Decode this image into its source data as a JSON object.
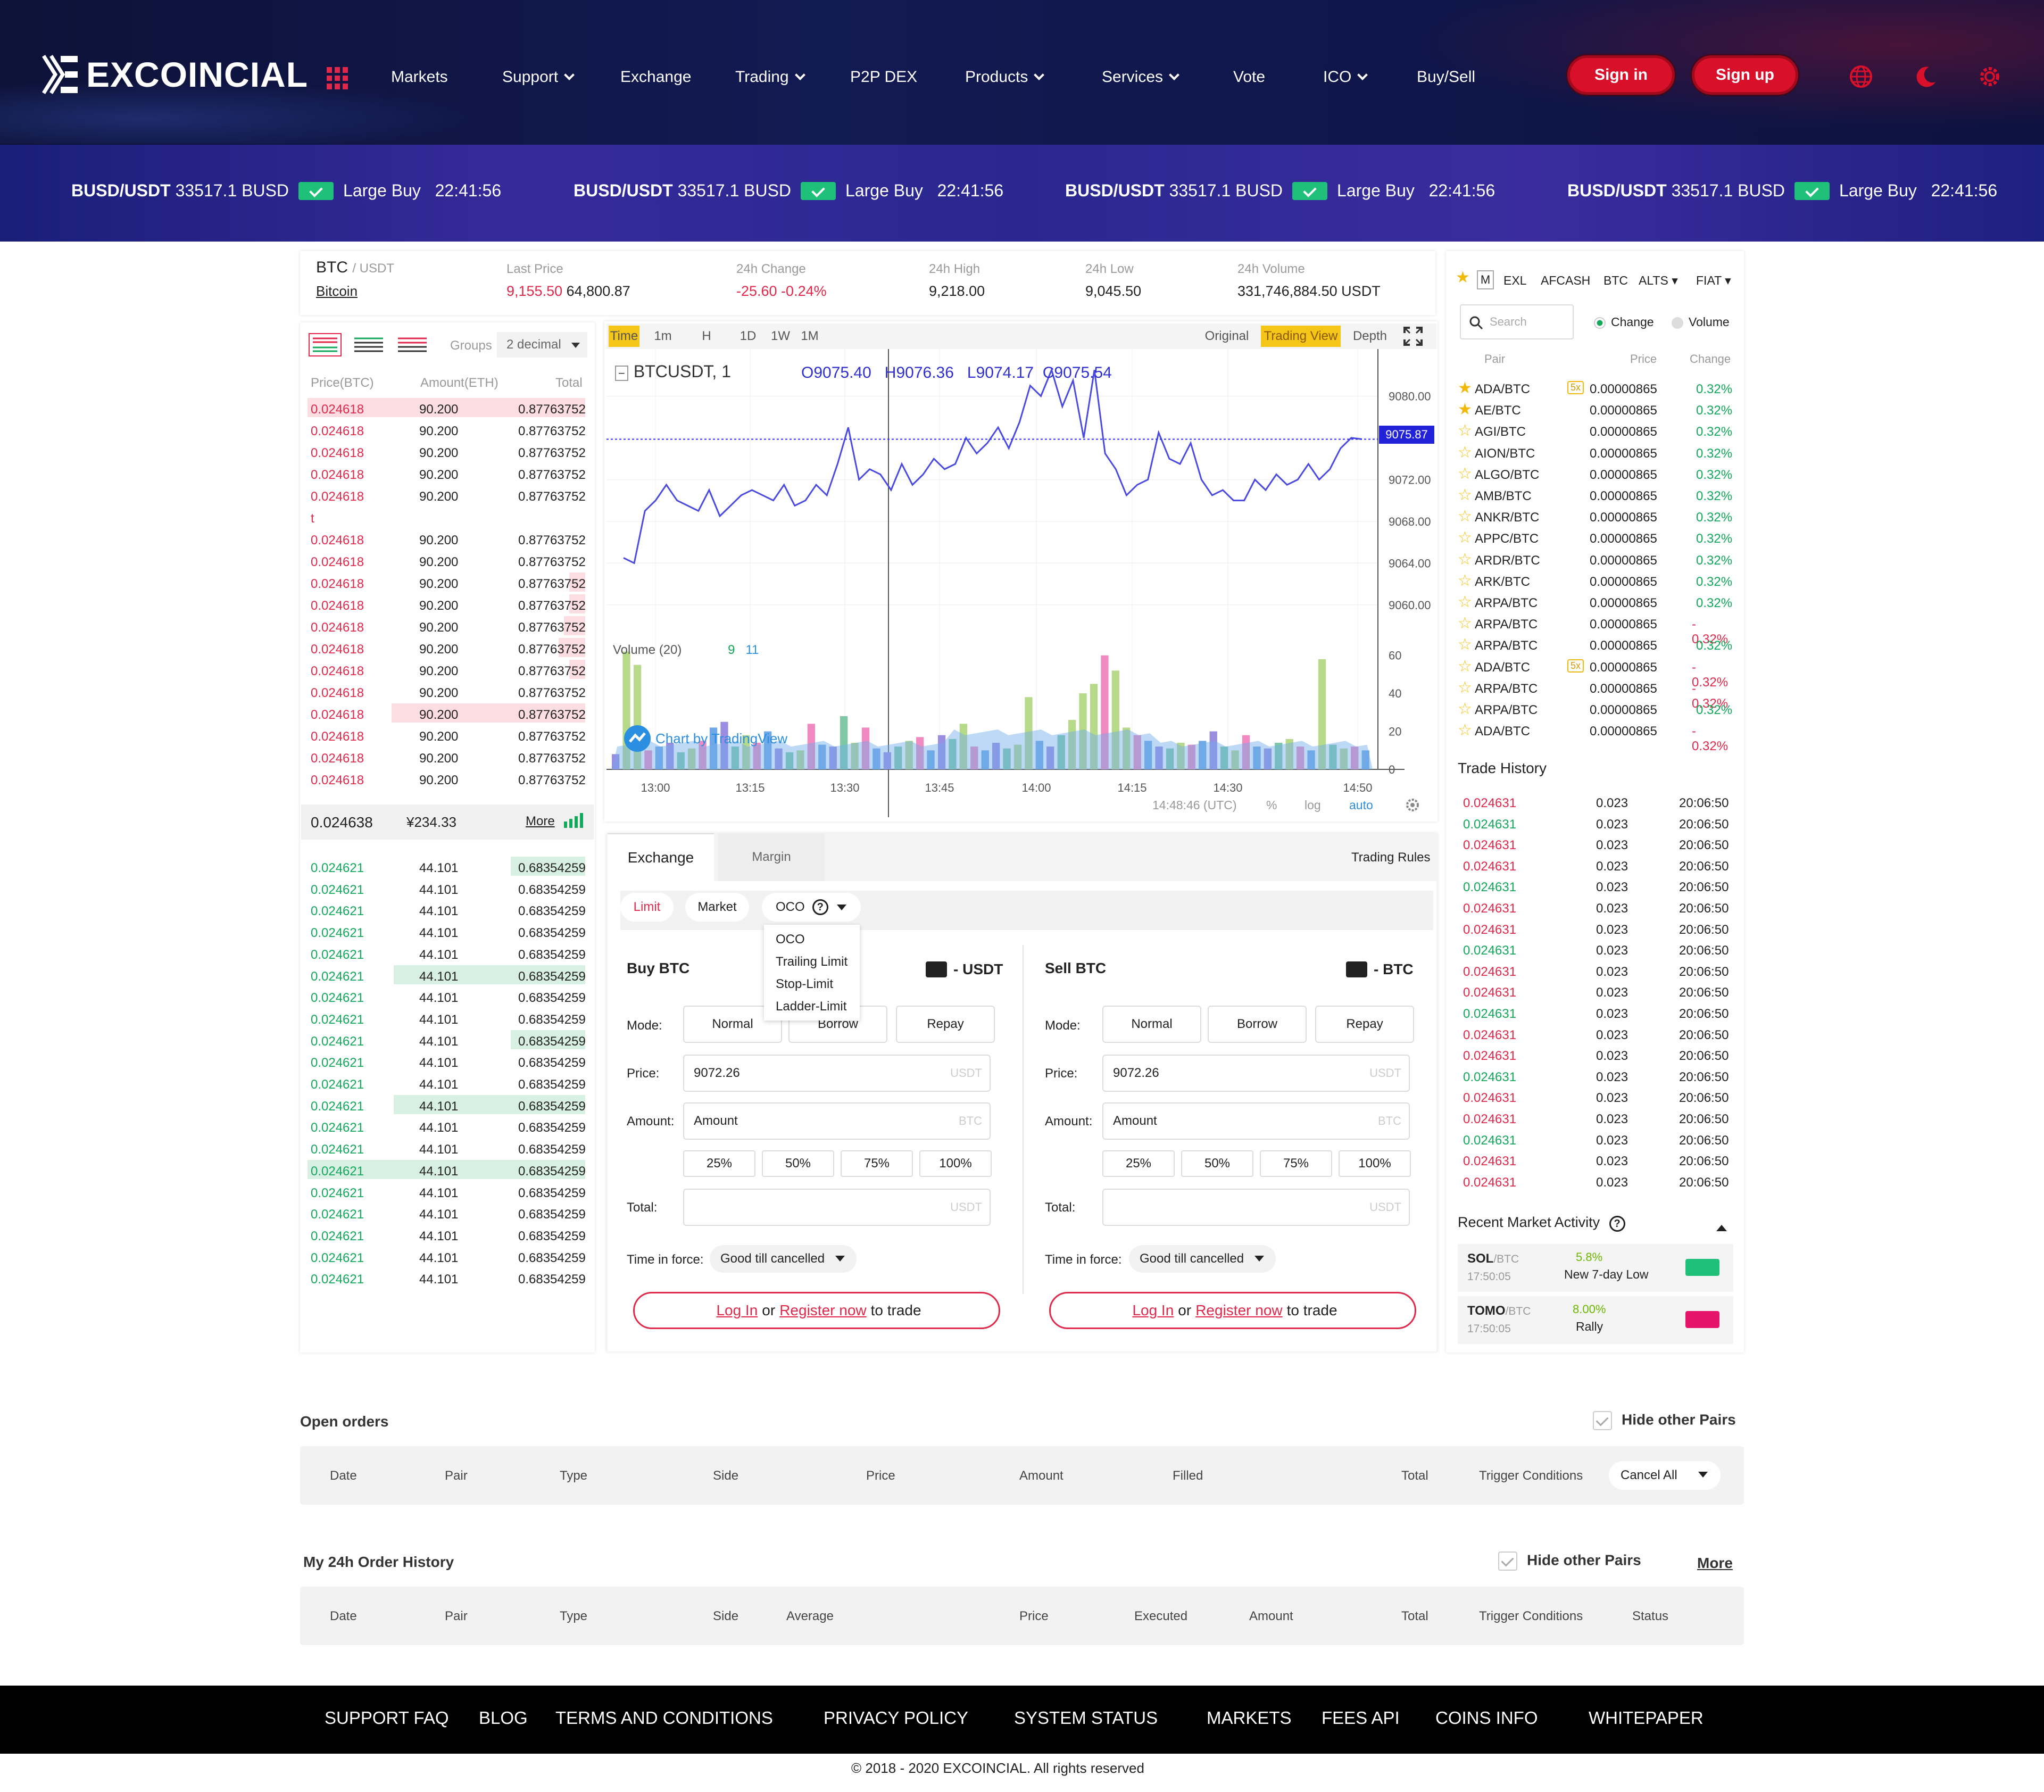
{
  "header": {
    "brand": "EXCOINCIAL",
    "nav": [
      "Markets",
      "Support",
      "Exchange",
      "Trading",
      "P2P DEX",
      "Products",
      "Services",
      "Vote",
      "ICO",
      "Buy/Sell"
    ],
    "signin": "Sign in",
    "signup": "Sign up"
  },
  "ticker": {
    "pair": "BUSD/USDT",
    "amount": "33517.1 BUSD",
    "label": "Large Buy",
    "time": "22:41:56"
  },
  "market_info": {
    "symbol": "BTC",
    "quote": "/ USDT",
    "name": "Bitcoin",
    "last_price_label": "Last Price",
    "last_price": "9,155.50",
    "last_price_alt": "64,800.87",
    "change_label": "24h Change",
    "change": "-25.60 -0.24%",
    "high_label": "24h High",
    "high": "9,218.00",
    "low_label": "24h Low",
    "low": "9,045.50",
    "volume_label": "24h Volume",
    "volume": "331,746,884.50 USDT"
  },
  "orderbook": {
    "groups_label": "Groups",
    "groups_value": "2 decimal",
    "col_price": "Price(BTC)",
    "col_amount": "Amount(ETH)",
    "col_total": "Total",
    "asks": [
      [
        "0.024618",
        "90.200",
        "0.87763752"
      ],
      [
        "0.024618",
        "90.200",
        "0.87763752"
      ],
      [
        "0.024618",
        "90.200",
        "0.87763752"
      ],
      [
        "0.024618",
        "90.200",
        "0.87763752"
      ],
      [
        "0.024618",
        "90.200",
        "0.87763752"
      ],
      [
        "t",
        "",
        ""
      ],
      [
        "0.024618",
        "90.200",
        "0.87763752"
      ],
      [
        "0.024618",
        "90.200",
        "0.87763752"
      ],
      [
        "0.024618",
        "90.200",
        "0.87763752"
      ],
      [
        "0.024618",
        "90.200",
        "0.87763752"
      ],
      [
        "0.024618",
        "90.200",
        "0.87763752"
      ],
      [
        "0.024618",
        "90.200",
        "0.87763752"
      ],
      [
        "0.024618",
        "90.200",
        "0.87763752"
      ],
      [
        "0.024618",
        "90.200",
        "0.87763752"
      ],
      [
        "0.024618",
        "90.200",
        "0.87763752"
      ],
      [
        "0.024618",
        "90.200",
        "0.87763752"
      ],
      [
        "0.024618",
        "90.200",
        "0.87763752"
      ],
      [
        "0.024618",
        "90.200",
        "0.87763752"
      ]
    ],
    "mid_price": "0.024638",
    "mid_fiat": "¥234.33",
    "more": "More",
    "bids": [
      [
        "0.024621",
        "44.101",
        "0.68354259"
      ],
      [
        "0.024621",
        "44.101",
        "0.68354259"
      ],
      [
        "0.024621",
        "44.101",
        "0.68354259"
      ],
      [
        "0.024621",
        "44.101",
        "0.68354259"
      ],
      [
        "0.024621",
        "44.101",
        "0.68354259"
      ],
      [
        "0.024621",
        "44.101",
        "0.68354259"
      ],
      [
        "0.024621",
        "44.101",
        "0.68354259"
      ],
      [
        "0.024621",
        "44.101",
        "0.68354259"
      ],
      [
        "0.024621",
        "44.101",
        "0.68354259"
      ],
      [
        "0.024621",
        "44.101",
        "0.68354259"
      ],
      [
        "0.024621",
        "44.101",
        "0.68354259"
      ],
      [
        "0.024621",
        "44.101",
        "0.68354259"
      ],
      [
        "0.024621",
        "44.101",
        "0.68354259"
      ],
      [
        "0.024621",
        "44.101",
        "0.68354259"
      ],
      [
        "0.024621",
        "44.101",
        "0.68354259"
      ],
      [
        "0.024621",
        "44.101",
        "0.68354259"
      ],
      [
        "0.024621",
        "44.101",
        "0.68354259"
      ],
      [
        "0.024621",
        "44.101",
        "0.68354259"
      ],
      [
        "0.024621",
        "44.101",
        "0.68354259"
      ],
      [
        "0.024621",
        "44.101",
        "0.68354259"
      ]
    ]
  },
  "chart_toolbar": {
    "intervals": [
      "Time",
      "1m",
      "H",
      "1D",
      "1W",
      "1M"
    ],
    "views": [
      "Original",
      "Trading View",
      "Depth"
    ]
  },
  "chart_data": {
    "type": "line",
    "title": "BTCUSDT, 1",
    "ohlc": {
      "o": "O9075.40",
      "h": "H9076.36",
      "l": "L9074.17",
      "c": "C9075.54"
    },
    "y_ticks": [
      "9080.00",
      "9076.00",
      "9072.00",
      "9068.00",
      "9064.00",
      "9060.00"
    ],
    "ylim": [
      9058,
      9084
    ],
    "last_value": "9075.87",
    "x_ticks": [
      "13:00",
      "13:15",
      "13:30",
      "13:45",
      "14:00",
      "14:15",
      "14:30",
      "14:50"
    ],
    "price": [
      9064.5,
      9064.0,
      9069.0,
      9070.0,
      9071.5,
      9070.0,
      9069.5,
      9069.0,
      9071.0,
      9068.5,
      9069.5,
      9070.5,
      9071.0,
      9070.5,
      9070.0,
      9071.5,
      9069.5,
      9070.0,
      9071.5,
      9070.5,
      9073.5,
      9077.0,
      9072.0,
      9073.0,
      9072.5,
      9071.0,
      9073.5,
      9071.5,
      9072.5,
      9074.0,
      9073.0,
      9073.5,
      9076.0,
      9074.5,
      9075.5,
      9077.0,
      9075.0,
      9077.5,
      9081.0,
      9080.0,
      9082.5,
      9079.0,
      9081.5,
      9076.0,
      9082.5,
      9074.5,
      9073.0,
      9070.5,
      9071.5,
      9072.0,
      9076.5,
      9074.0,
      9073.5,
      9075.5,
      9072.0,
      9070.5,
      9071.0,
      9070.0,
      9070.0,
      9072.0,
      9071.0,
      9072.5,
      9071.5,
      9072.0,
      9073.5,
      9072.0,
      9073.0,
      9075.0,
      9076.0,
      9075.87
    ],
    "volume_label": "Volume (20)",
    "volume_vals": [
      "9",
      "11"
    ],
    "volume_ticks": [
      "60",
      "40",
      "20",
      "0"
    ],
    "volume": [
      8,
      62,
      55,
      10,
      12,
      14,
      9,
      11,
      15,
      22,
      25,
      12,
      18,
      14,
      20,
      11,
      9,
      10,
      24,
      13,
      12,
      28,
      14,
      22,
      11,
      9,
      12,
      15,
      17,
      10,
      18,
      16,
      24,
      12,
      10,
      14,
      11,
      13,
      38,
      15,
      12,
      18,
      26,
      40,
      45,
      60,
      52,
      22,
      18,
      15,
      12,
      11,
      14,
      13,
      15,
      20,
      12,
      10,
      18,
      12,
      11,
      14,
      16,
      12,
      10,
      58,
      13,
      11,
      12,
      10
    ],
    "watermark": "Chart by TradingView",
    "time_readout": "14:48:46 (UTC)",
    "opts": [
      "%",
      "log",
      "auto"
    ]
  },
  "trade": {
    "tabs": [
      "Exchange",
      "Margin"
    ],
    "rules": "Trading Rules",
    "types": [
      "Limit",
      "Market",
      "OCO"
    ],
    "oco_menu": [
      "OCO",
      "Trailing Limit",
      "Stop-Limit",
      "Ladder-Limit"
    ],
    "buy_title": "Buy BTC",
    "buy_wallet": "- USDT",
    "sell_title": "Sell BTC",
    "sell_wallet": "- BTC",
    "mode_label": "Mode:",
    "modes": [
      "Normal",
      "Borrow",
      "Repay"
    ],
    "price_label": "Price:",
    "price_value": "9072.26",
    "price_unit": "USDT",
    "amount_label": "Amount:",
    "amount_placeholder": "Amount",
    "amount_unit": "BTC",
    "pcts": [
      "25%",
      "50%",
      "75%",
      "100%"
    ],
    "total_label": "Total:",
    "total_unit": "USDT",
    "tif_label": "Time in force:",
    "tif_value": "Good till cancelled",
    "login": "Log In",
    "or": "or",
    "register": "Register now",
    "to_trade": "to trade"
  },
  "markets": {
    "tabs": [
      "M",
      "EXL",
      "AFCASH",
      "BTC",
      "ALTS",
      "FIAT"
    ],
    "search_placeholder": "Search",
    "change_label": "Change",
    "volume_label": "Volume",
    "col_pair": "Pair",
    "col_price": "Price",
    "col_change": "Change",
    "rows": [
      [
        "ADA/BTC",
        "0.00000865",
        "0.32%",
        "5x"
      ],
      [
        "AE/BTC",
        "0.00000865",
        "0.32%",
        ""
      ],
      [
        "AGI/BTC",
        "0.00000865",
        "0.32%",
        ""
      ],
      [
        "AION/BTC",
        "0.00000865",
        "0.32%",
        ""
      ],
      [
        "ALGO/BTC",
        "0.00000865",
        "0.32%",
        ""
      ],
      [
        "AMB/BTC",
        "0.00000865",
        "0.32%",
        ""
      ],
      [
        "ANKR/BTC",
        "0.00000865",
        "0.32%",
        ""
      ],
      [
        "APPC/BTC",
        "0.00000865",
        "0.32%",
        ""
      ],
      [
        "ARDR/BTC",
        "0.00000865",
        "0.32%",
        ""
      ],
      [
        "ARK/BTC",
        "0.00000865",
        "0.32%",
        ""
      ],
      [
        "ARPA/BTC",
        "0.00000865",
        "0.32%",
        ""
      ],
      [
        "ARPA/BTC",
        "0.00000865",
        "- 0.32%",
        ""
      ],
      [
        "ARPA/BTC",
        "0.00000865",
        "0.32%",
        ""
      ],
      [
        "ADA/BTC",
        "0.00000865",
        "- 0.32%",
        "5x"
      ],
      [
        "ARPA/BTC",
        "0.00000865",
        "- 0.32%",
        ""
      ],
      [
        "ARPA/BTC",
        "0.00000865",
        "0.32%",
        ""
      ],
      [
        "ADA/BTC",
        "0.00000865",
        "- 0.32%",
        ""
      ]
    ]
  },
  "trade_history": {
    "title": "Trade History",
    "rows": [
      [
        "0.024631",
        "0.023",
        "20:06:50",
        "r"
      ],
      [
        "0.024631",
        "0.023",
        "20:06:50",
        "g"
      ],
      [
        "0.024631",
        "0.023",
        "20:06:50",
        "r"
      ],
      [
        "0.024631",
        "0.023",
        "20:06:50",
        "r"
      ],
      [
        "0.024631",
        "0.023",
        "20:06:50",
        "g"
      ],
      [
        "0.024631",
        "0.023",
        "20:06:50",
        "r"
      ],
      [
        "0.024631",
        "0.023",
        "20:06:50",
        "r"
      ],
      [
        "0.024631",
        "0.023",
        "20:06:50",
        "g"
      ],
      [
        "0.024631",
        "0.023",
        "20:06:50",
        "r"
      ],
      [
        "0.024631",
        "0.023",
        "20:06:50",
        "r"
      ],
      [
        "0.024631",
        "0.023",
        "20:06:50",
        "g"
      ],
      [
        "0.024631",
        "0.023",
        "20:06:50",
        "r"
      ],
      [
        "0.024631",
        "0.023",
        "20:06:50",
        "r"
      ],
      [
        "0.024631",
        "0.023",
        "20:06:50",
        "g"
      ],
      [
        "0.024631",
        "0.023",
        "20:06:50",
        "r"
      ],
      [
        "0.024631",
        "0.023",
        "20:06:50",
        "r"
      ],
      [
        "0.024631",
        "0.023",
        "20:06:50",
        "g"
      ],
      [
        "0.024631",
        "0.023",
        "20:06:50",
        "r"
      ],
      [
        "0.024631",
        "0.023",
        "20:06:50",
        "r"
      ]
    ]
  },
  "activity": {
    "title": "Recent Market Activity",
    "items": [
      {
        "pair": "SOL",
        "quote": "/BTC",
        "time": "17:50:05",
        "pct": "5.8%",
        "desc": "New 7-day Low",
        "color": "#1fc07a"
      },
      {
        "pair": "TOMO",
        "quote": "/BTC",
        "time": "17:50:05",
        "pct": "8.00%",
        "desc": "Rally",
        "color": "#e5136a"
      }
    ]
  },
  "open_orders": {
    "title": "Open orders",
    "hide": "Hide other Pairs",
    "cols": [
      "Date",
      "Pair",
      "Type",
      "Side",
      "Price",
      "Amount",
      "Filled",
      "Total",
      "Trigger Conditions"
    ],
    "cancel": "Cancel All"
  },
  "order_history": {
    "title": "My 24h Order History",
    "hide": "Hide other Pairs",
    "more": "More",
    "cols": [
      "Date",
      "Pair",
      "Type",
      "Side",
      "Average",
      "Price",
      "Executed",
      "Amount",
      "Total",
      "Trigger Conditions",
      "Status"
    ]
  },
  "footer": {
    "links": [
      "SUPPORT FAQ",
      "BLOG",
      "TERMS AND CONDITIONS",
      "PRIVACY POLICY",
      "SYSTEM STATUS",
      "MARKETS",
      "FEES API",
      "COINS INFO",
      "WHITEPAPER"
    ],
    "copyright": "© 2018 - 2020 EXCOINCIAL. All rights reserved"
  },
  "colors": {
    "red": "#e0294a",
    "green": "#13a85a",
    "brand_red": "#d8102a",
    "line": "#4a4ae0"
  }
}
